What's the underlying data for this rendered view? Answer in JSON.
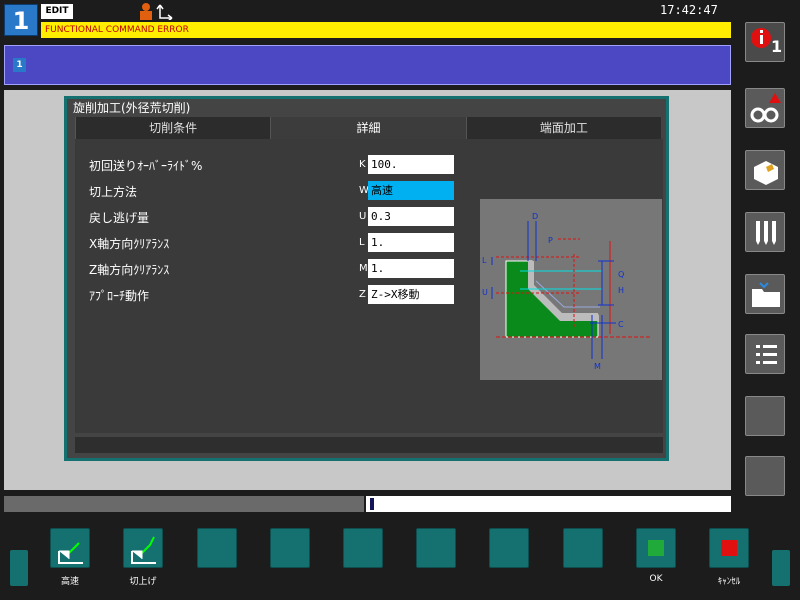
{
  "header": {
    "path_number": "1",
    "mode": "EDIT",
    "clock": "17:42:47",
    "alarm_text": "FUNCTIONAL COMMAND ERROR",
    "sub_path": "1"
  },
  "dialog": {
    "title": "旋削加工(外径荒切削)",
    "tabs": [
      {
        "label": "切削条件",
        "active": false
      },
      {
        "label": "詳細",
        "active": true
      },
      {
        "label": "端面加工",
        "active": false
      }
    ],
    "fields": [
      {
        "label": "初回送りｵｰﾊﾞｰﾗｲﾄﾞ%",
        "letter": "K",
        "value": "100."
      },
      {
        "label": "切上方法",
        "letter": "W",
        "value": "高速"
      },
      {
        "label": "戻し逃げ量",
        "letter": "U",
        "value": "0.3"
      },
      {
        "label": "X軸方向ｸﾘｱﾗﾝｽ",
        "letter": "L",
        "value": "1."
      },
      {
        "label": "Z軸方向ｸﾘｱﾗﾝｽ",
        "letter": "M",
        "value": "1."
      },
      {
        "label": "ｱﾌﾟﾛｰﾁ動作",
        "letter": "Z",
        "value": "Z->X移動"
      }
    ],
    "diagram_labels": {
      "d": "D",
      "p": "P",
      "l": "L",
      "u": "U",
      "q": "Q",
      "h": "H",
      "c": "C",
      "m": "M"
    }
  },
  "side_buttons": {
    "alarm_count": "1"
  },
  "softkeys": [
    {
      "label": "高速"
    },
    {
      "label": "切上げ"
    },
    {
      "label": ""
    },
    {
      "label": ""
    },
    {
      "label": ""
    },
    {
      "label": ""
    },
    {
      "label": ""
    },
    {
      "label": ""
    },
    {
      "label": "OK"
    },
    {
      "label": "ｷｬﾝｾﾙ"
    }
  ],
  "colors": {
    "accent": "#157070",
    "alarm_bg": "#ffee00",
    "alarm_text": "#c00000",
    "selected_field": "#00b0f0",
    "ok_green": "#1faa3a",
    "cancel_red": "#e01010"
  }
}
